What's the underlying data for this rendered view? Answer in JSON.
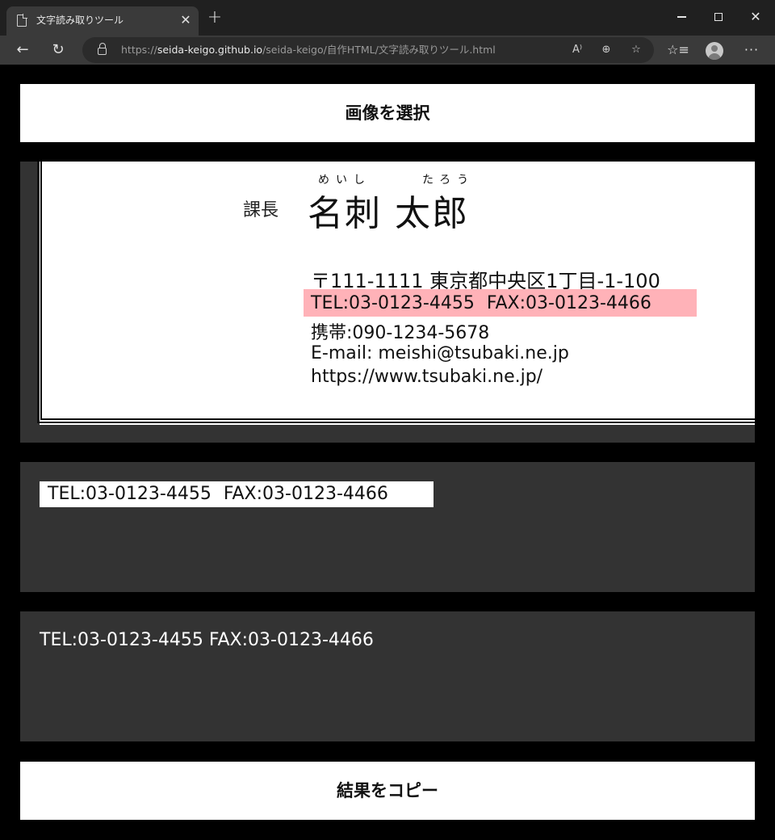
{
  "browser": {
    "tab_title": "文字読み取りツール",
    "url_scheme": "https://",
    "url_host": "seida-keigo.github.io",
    "url_path": "/seida-keigo/自作HTML/文字読み取りツール.html",
    "icons": {
      "tab": "document-icon",
      "close": "close-icon",
      "new_tab": "plus-icon",
      "back": "back-arrow-icon",
      "reload": "reload-icon",
      "lock": "lock-icon",
      "read_aloud": "read-aloud-icon",
      "zoom": "zoom-icon",
      "favorite_add": "favorite-add-icon",
      "favorites": "favorites-icon",
      "profile": "profile-icon",
      "more": "more-icon"
    }
  },
  "page": {
    "select_button": "画像を選択",
    "copy_button": "結果をコピー"
  },
  "card": {
    "furigana_first": "めいし",
    "furigana_last": "たろう",
    "role": "課長",
    "name": "名刺 太郎",
    "address": "〒111-1111 東京都中央区1丁目-1-100",
    "tel_fax": "TEL:03-0123-4455 FAX:03-0123-4466",
    "mobile": "携帯:090-1234-5678",
    "email": "E-mail: meishi@tsubaki.ne.jp",
    "url": "https://www.tsubaki.ne.jp/",
    "highlight_color": "#ffb2b8"
  },
  "crop": {
    "text": "TEL:03-0123-4455 FAX:03-0123-4466"
  },
  "result": {
    "text": "TEL:03-0123-4455 FAX:03-0123-4466"
  }
}
